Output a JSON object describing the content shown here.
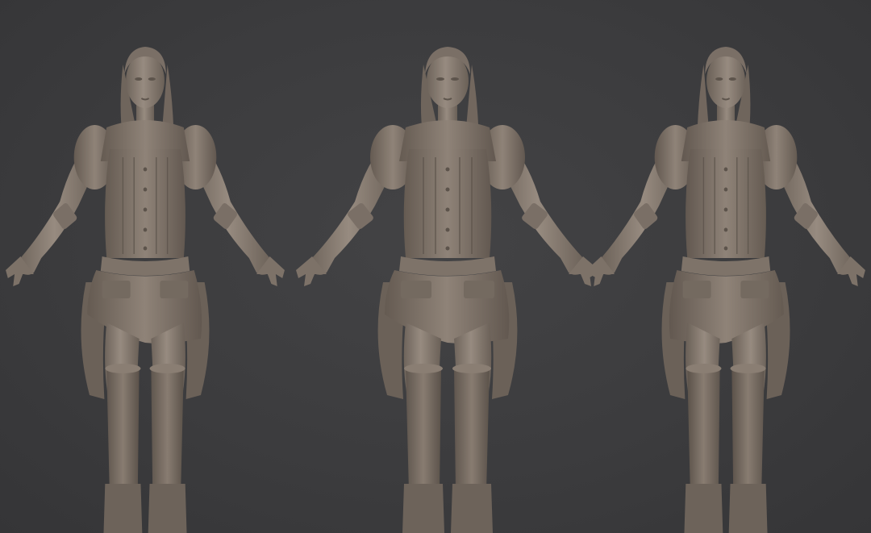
{
  "viewport": {
    "background": "#3b3b3d",
    "material_color": "#8a7f75",
    "material_shadow": "#5e554d",
    "material_highlight": "#a89c90"
  },
  "models": [
    {
      "view": "three-quarter-right"
    },
    {
      "view": "front"
    },
    {
      "view": "three-quarter-left"
    }
  ]
}
